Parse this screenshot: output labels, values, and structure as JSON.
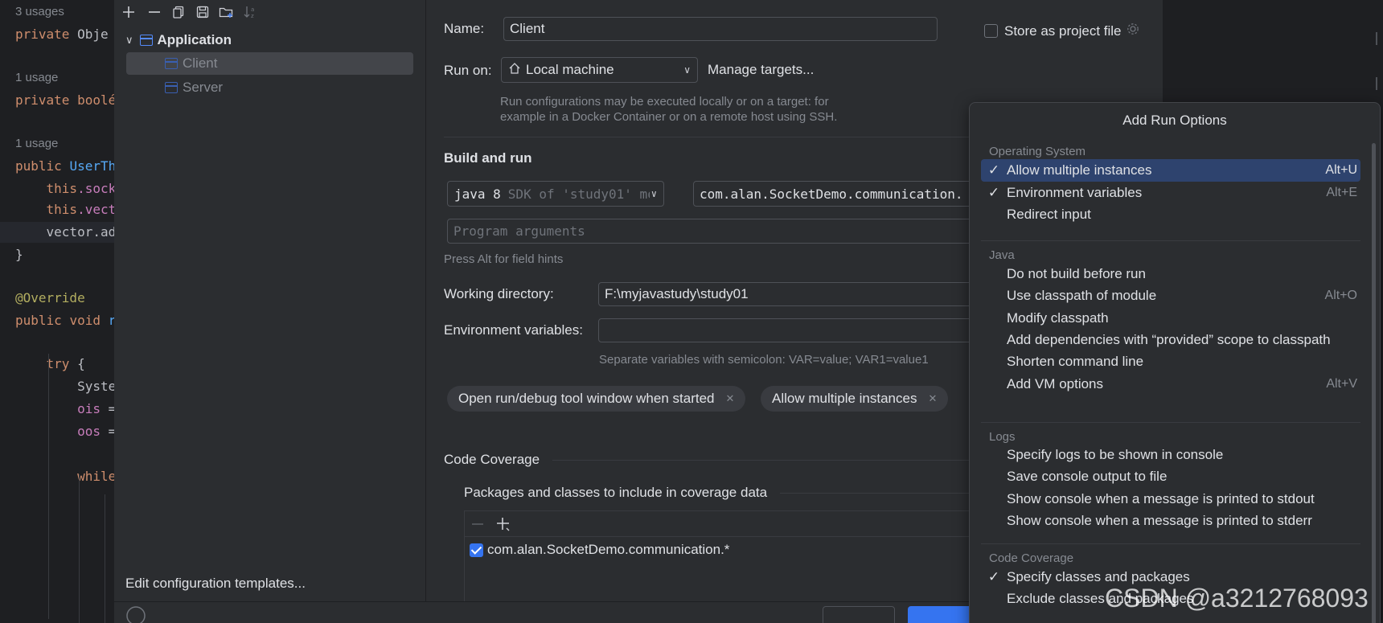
{
  "editor": {
    "lines": [
      {
        "segments": [
          {
            "t": "3 usages",
            "c": "hint"
          }
        ]
      },
      {
        "segments": [
          {
            "t": "private ",
            "c": "kw"
          },
          {
            "t": "Obje",
            "c": "plain"
          }
        ]
      },
      {
        "segments": [
          {
            "t": "1 usage",
            "c": "hint"
          }
        ]
      },
      {
        "segments": [
          {
            "t": "private ",
            "c": "kw"
          },
          {
            "t": "boolé",
            "c": "kw"
          }
        ]
      },
      {
        "segments": [
          {
            "t": "1 usage",
            "c": "hint"
          }
        ]
      },
      {
        "segments": [
          {
            "t": "public ",
            "c": "kw"
          },
          {
            "t": "UserTh",
            "c": "ty"
          }
        ]
      },
      {
        "segments": [
          {
            "t": "    ",
            "c": "plain"
          },
          {
            "t": "this",
            "c": "kw"
          },
          {
            "t": ".sock",
            "c": "fld"
          }
        ]
      },
      {
        "segments": [
          {
            "t": "    ",
            "c": "plain"
          },
          {
            "t": "this",
            "c": "kw"
          },
          {
            "t": ".vect",
            "c": "fld"
          }
        ]
      },
      {
        "segments": [
          {
            "t": "    vector.ad",
            "c": "plain"
          }
        ]
      },
      {
        "segments": [
          {
            "t": "}",
            "c": "plain"
          }
        ]
      },
      {
        "segments": [
          {
            "t": "@Override",
            "c": "ann"
          }
        ]
      },
      {
        "segments": [
          {
            "t": "public ",
            "c": "kw"
          },
          {
            "t": "void ",
            "c": "kw"
          },
          {
            "t": "r",
            "c": "ty"
          }
        ]
      },
      {
        "segments": [
          {
            "t": "    ",
            "c": "plain"
          },
          {
            "t": "try ",
            "c": "kw"
          },
          {
            "t": "{",
            "c": "plain"
          }
        ]
      },
      {
        "segments": [
          {
            "t": "        Syste",
            "c": "plain"
          }
        ]
      },
      {
        "segments": [
          {
            "t": "        ",
            "c": "plain"
          },
          {
            "t": "ois ",
            "c": "fld"
          },
          {
            "t": "=",
            "c": "plain"
          }
        ]
      },
      {
        "segments": [
          {
            "t": "        ",
            "c": "plain"
          },
          {
            "t": "oos ",
            "c": "fld"
          },
          {
            "t": "=",
            "c": "plain"
          }
        ]
      },
      {
        "segments": [
          {
            "t": "        ",
            "c": "plain"
          },
          {
            "t": "while",
            "c": "kw"
          }
        ]
      }
    ]
  },
  "toolbar": {
    "icons": [
      "add-icon",
      "remove-icon",
      "copy-icon",
      "save-icon",
      "new-folder-icon",
      "sort-icon"
    ]
  },
  "tree": {
    "group": "Application",
    "items": [
      "Client",
      "Server"
    ]
  },
  "edit_templates_link": "Edit configuration templates...",
  "form": {
    "name_label": "Name:",
    "name_value": "Client",
    "store_label": "Store as project file",
    "run_on_label": "Run on:",
    "run_on_value": "Local machine",
    "manage_targets": "Manage targets...",
    "run_on_hint_1": "Run configurations may be executed locally or on a target: for",
    "run_on_hint_2": "example in a Docker Container or on a remote host using SSH.",
    "build_and_run": "Build and run",
    "jdk_main": "java 8",
    "jdk_sub": "SDK of 'study01' mo",
    "main_class": "com.alan.SocketDemo.communication.",
    "program_args_placeholder": "Program arguments",
    "alt_hint": "Press Alt for field hints",
    "working_dir_label": "Working directory:",
    "working_dir_value": "F:\\myjavastudy\\study01",
    "env_vars_label": "Environment variables:",
    "env_vars_value": "",
    "env_hint": "Separate variables with semicolon: VAR=value; VAR1=value1",
    "chips": [
      "Open run/debug tool window when started",
      "Allow multiple instances"
    ],
    "code_coverage": "Code Coverage",
    "packages_label": "Packages and classes to include in coverage data",
    "coverage_items": [
      {
        "checked": true,
        "text": "com.alan.SocketDemo.communication.*"
      }
    ]
  },
  "popup": {
    "title": "Add Run Options",
    "groups": [
      {
        "name": "Operating System",
        "items": [
          {
            "label": "Allow multiple instances",
            "checked": true,
            "shortcut": "Alt+U",
            "selected": true
          },
          {
            "label": "Environment variables",
            "checked": true,
            "shortcut": "Alt+E"
          },
          {
            "label": "Redirect input",
            "checked": false,
            "shortcut": ""
          }
        ]
      },
      {
        "name": "Java",
        "items": [
          {
            "label": "Do not build before run",
            "checked": false,
            "shortcut": ""
          },
          {
            "label": "Use classpath of module",
            "checked": false,
            "shortcut": "Alt+O"
          },
          {
            "label": "Modify classpath",
            "checked": false,
            "shortcut": ""
          },
          {
            "label": "Add dependencies with “provided” scope to classpath",
            "checked": false,
            "shortcut": ""
          },
          {
            "label": "Shorten command line",
            "checked": false,
            "shortcut": ""
          },
          {
            "label": "Add VM options",
            "checked": false,
            "shortcut": "Alt+V"
          }
        ]
      },
      {
        "name": "Logs",
        "items": [
          {
            "label": "Specify logs to be shown in console",
            "checked": false,
            "shortcut": ""
          },
          {
            "label": "Save console output to file",
            "checked": false,
            "shortcut": ""
          },
          {
            "label": "Show console when a message is printed to stdout",
            "checked": false,
            "shortcut": ""
          },
          {
            "label": "Show console when a message is printed to stderr",
            "checked": false,
            "shortcut": ""
          }
        ]
      },
      {
        "name": "Code Coverage",
        "items": [
          {
            "label": "Specify classes and packages",
            "checked": true,
            "shortcut": ""
          },
          {
            "label": "Exclude classes and packages",
            "checked": false,
            "shortcut": ""
          }
        ]
      }
    ]
  },
  "watermark": "CSDN @a3212768093",
  "colors": {
    "accent": "#3574f0",
    "link": "#548af7",
    "selection": "#2e436e"
  }
}
